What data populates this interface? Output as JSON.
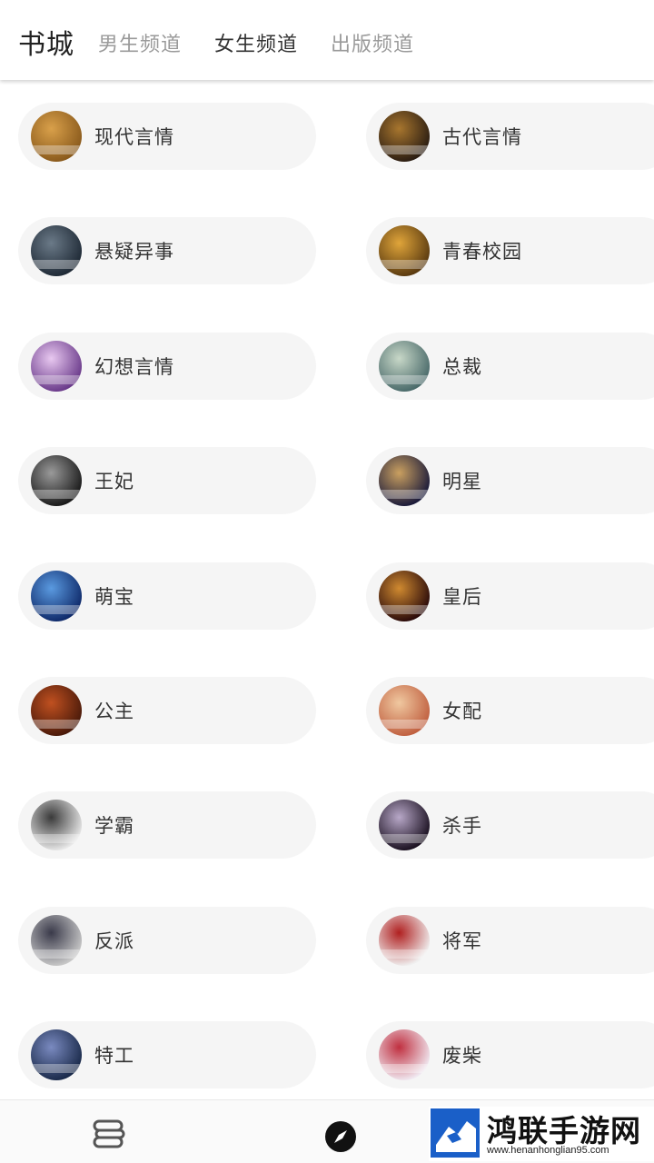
{
  "header": {
    "title": "书城",
    "tabs": [
      {
        "label": "男生频道",
        "active": false
      },
      {
        "label": "女生频道",
        "active": true
      },
      {
        "label": "出版频道",
        "active": false
      }
    ]
  },
  "categories": [
    {
      "label": "现代言情",
      "colors": [
        "#8a5a1c",
        "#d9a04a"
      ]
    },
    {
      "label": "古代言情",
      "colors": [
        "#2b1d12",
        "#a8762e"
      ]
    },
    {
      "label": "悬疑异事",
      "colors": [
        "#1f2a36",
        "#6b7a88"
      ]
    },
    {
      "label": "青春校园",
      "colors": [
        "#5a3a10",
        "#e0a53a"
      ]
    },
    {
      "label": "幻想言情",
      "colors": [
        "#6a3a8a",
        "#e8c8f0"
      ]
    },
    {
      "label": "总裁",
      "colors": [
        "#4a6a6a",
        "#c8d8c8"
      ]
    },
    {
      "label": "王妃",
      "colors": [
        "#1a1a1a",
        "#9a9a9a"
      ]
    },
    {
      "label": "明星",
      "colors": [
        "#1a1a3a",
        "#caa060"
      ]
    },
    {
      "label": "萌宝",
      "colors": [
        "#0f2a6a",
        "#5a9ae0"
      ]
    },
    {
      "label": "皇后",
      "colors": [
        "#2a0a0a",
        "#d08a30"
      ]
    },
    {
      "label": "公主",
      "colors": [
        "#4a1a0a",
        "#c05020"
      ]
    },
    {
      "label": "女配",
      "colors": [
        "#c06040",
        "#f0c8a0"
      ]
    },
    {
      "label": "学霸",
      "colors": [
        "#e8e8e8",
        "#3a3a3a"
      ]
    },
    {
      "label": "杀手",
      "colors": [
        "#1a1020",
        "#b8a8c8"
      ]
    },
    {
      "label": "反派",
      "colors": [
        "#c8c8c8",
        "#3a3a4a"
      ]
    },
    {
      "label": "将军",
      "colors": [
        "#f0f0f0",
        "#b02020"
      ]
    },
    {
      "label": "特工",
      "colors": [
        "#1a2a4a",
        "#7a8ac0"
      ]
    },
    {
      "label": "废柴",
      "colors": [
        "#f0e8f0",
        "#c03040"
      ]
    }
  ],
  "bottom_nav": [
    {
      "name": "bookshelf-icon"
    },
    {
      "name": "discover-compass-icon"
    }
  ],
  "watermark": {
    "name": "鸿联手游网",
    "url": "www.henanhonglian95.com",
    "logo_color": "#1a5fc8"
  }
}
